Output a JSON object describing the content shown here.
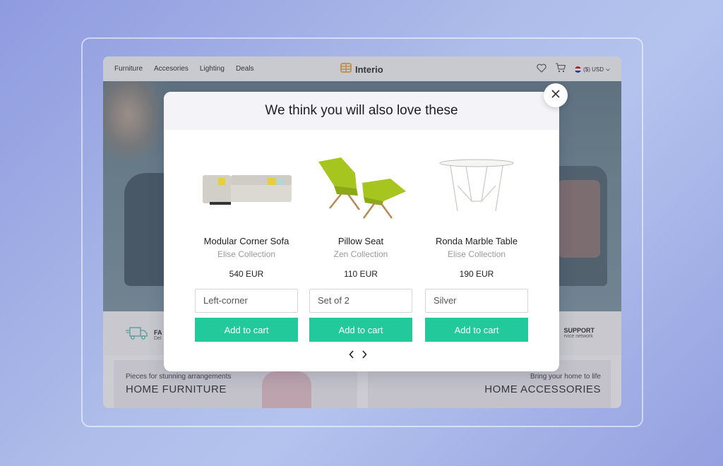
{
  "site": {
    "nav": [
      "Furniture",
      "Accesories",
      "Lighting",
      "Deals"
    ],
    "brand": "Interio",
    "currency": "($) USD",
    "icons": [
      "heart-icon",
      "cart-icon",
      "us-flag-icon",
      "chevron-down-icon"
    ]
  },
  "features": {
    "left_title": "FA",
    "left_sub": "Del",
    "right_title": "SUPPORT",
    "right_sub": "rvice network"
  },
  "banners": {
    "left_small": "Pieces for stunning arrangements",
    "left_big": "HOME FURNITURE",
    "right_small": "Bring your home to life",
    "right_big": "HOME ACCESSORIES"
  },
  "modal": {
    "title": "We think you will also love these",
    "products": [
      {
        "name": "Modular Corner Sofa",
        "collection": "Elise Collection",
        "price": "540 EUR",
        "variant": "Left-corner",
        "button": "Add to cart"
      },
      {
        "name": "Pillow Seat",
        "collection": "Zen Collection",
        "price": "110 EUR",
        "variant": "Set of 2",
        "button": "Add to cart"
      },
      {
        "name": "Ronda Marble Table",
        "collection": "Elise Collection",
        "price": "190 EUR",
        "variant": "Silver",
        "button": "Add to cart"
      }
    ]
  },
  "colors": {
    "accent": "#22c99b",
    "brand_orange": "#e8a33a"
  }
}
